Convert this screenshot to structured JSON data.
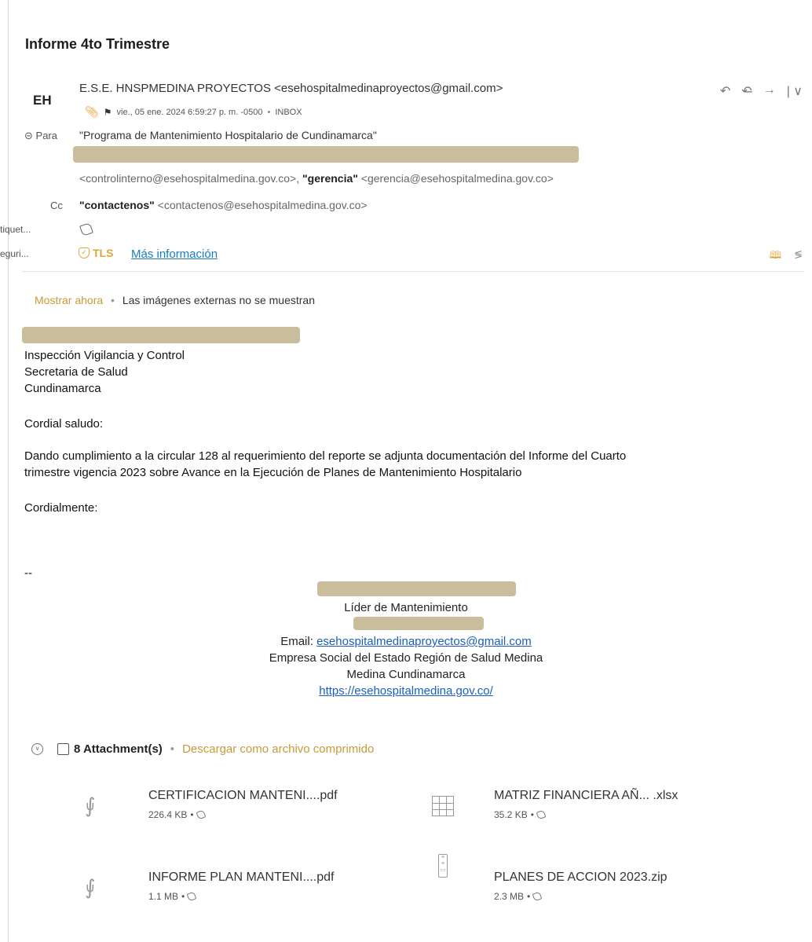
{
  "email": {
    "subject": "Informe 4to Trimestre",
    "avatar_initials": "EH",
    "sender": "E.S.E. HNSPMEDINA PROYECTOS <esehospitalmedinaproyectos@gmail.com>",
    "date": "vie., 05 ene. 2024 6:59:27 p. m. -0500",
    "folder": "INBOX",
    "to_label": "Para",
    "to_line1": "\"Programa de Mantenimiento Hospitalario de Cundinamarca\"",
    "to_line3_addr1": "<controlinterno@esehospitalmedina.gov.co>,",
    "to_line3_name2": "\"gerencia\"",
    "to_line3_addr2": "<gerencia@esehospitalmedina.gov.co>",
    "cc_label": "Cc",
    "cc_name": "\"contactenos\"",
    "cc_addr": "<contactenos@esehospitalmedina.gov.co>",
    "tags_label": "tiquet...",
    "security_label": "eguri...",
    "tls_label": "TLS",
    "more_info": "Más información"
  },
  "banner": {
    "show_now": "Mostrar ahora",
    "message": "Las imágenes externas no se muestran"
  },
  "body": {
    "line_ivc": "Inspección Vigilancia y Control",
    "line_secretaria": "Secretaria de Salud",
    "line_cundinamarca": "Cundinamarca",
    "greeting": "Cordial saludo:",
    "paragraph_1": "Dando cumplimiento a la circular 128 al requerimiento del reporte se adjunta documentación del Informe del Cuarto",
    "paragraph_2": "trimestre vigencia 2023 sobre Avance en la Ejecución de Planes de Mantenimiento Hospitalario",
    "closing": "Cordialmente:",
    "separator": "--"
  },
  "signature": {
    "role": "Líder de Mantenimiento",
    "email_label": "Email:",
    "email": "esehospitalmedinaproyectos@gmail.com",
    "org": "Empresa Social del Estado Región de Salud Medina",
    "city": "Medina Cundinamarca",
    "website": "https://esehospitalmedina.gov.co/"
  },
  "attachments": {
    "count_label": "8 Attachment(s)",
    "download_all": "Descargar como archivo comprimido",
    "items": [
      {
        "name": "CERTIFICACION MANTENI....pdf",
        "size": "226.4 KB",
        "icon": "pdf-icon"
      },
      {
        "name": "MATRIZ FINANCIERA AÑ...  .xlsx",
        "size": "35.2 KB",
        "icon": "spreadsheet-icon"
      },
      {
        "name": "INFORME PLAN MANTENI....pdf",
        "size": "1.1 MB",
        "icon": "pdf-icon"
      },
      {
        "name": "PLANES DE ACCION 2023.zip",
        "size": "2.3 MB",
        "icon": "zip-icon"
      }
    ]
  },
  "toolbar_icons": [
    "reply-icon",
    "reply-all-icon",
    "forward-icon",
    "more-chevron-icon"
  ]
}
